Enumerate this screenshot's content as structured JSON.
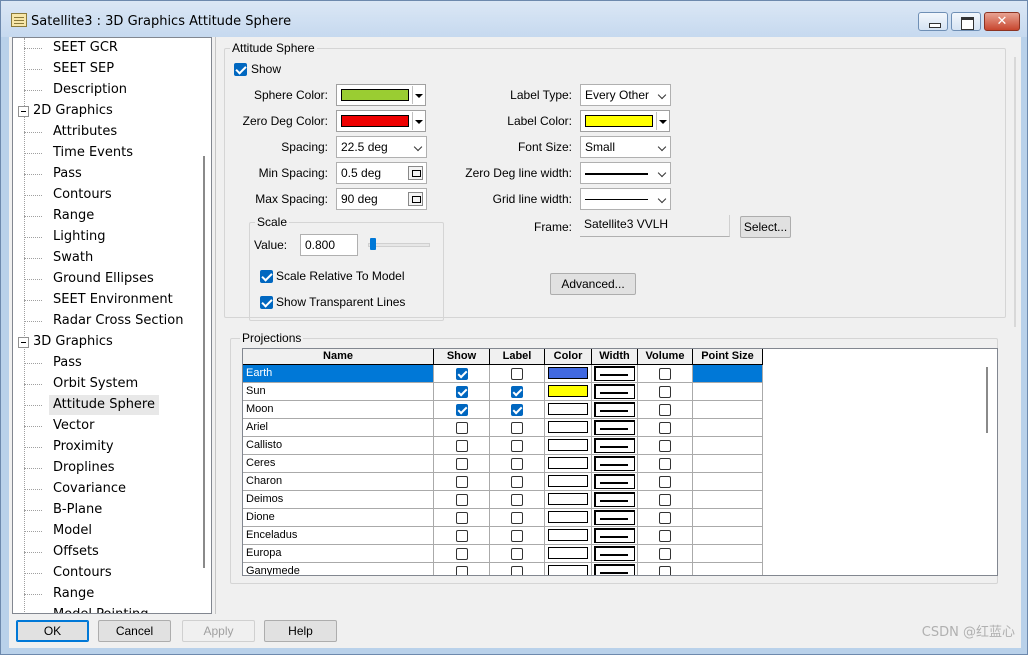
{
  "window": {
    "title": "Satellite3 : 3D Graphics Attitude Sphere",
    "close_glyph": "✕"
  },
  "tree": {
    "items": [
      {
        "label": "SEET GCR",
        "level": 1
      },
      {
        "label": "SEET SEP",
        "level": 1
      },
      {
        "label": "Description",
        "level": 1
      },
      {
        "label": "2D Graphics",
        "level": 0
      },
      {
        "label": "Attributes",
        "level": 1
      },
      {
        "label": "Time Events",
        "level": 1
      },
      {
        "label": "Pass",
        "level": 1
      },
      {
        "label": "Contours",
        "level": 1
      },
      {
        "label": "Range",
        "level": 1
      },
      {
        "label": "Lighting",
        "level": 1
      },
      {
        "label": "Swath",
        "level": 1
      },
      {
        "label": "Ground Ellipses",
        "level": 1
      },
      {
        "label": "SEET Environment",
        "level": 1
      },
      {
        "label": "Radar Cross Section",
        "level": 1
      },
      {
        "label": "3D Graphics",
        "level": 0
      },
      {
        "label": "Pass",
        "level": 1
      },
      {
        "label": "Orbit System",
        "level": 1
      },
      {
        "label": "Attitude Sphere",
        "level": 1
      },
      {
        "label": "Vector",
        "level": 1
      },
      {
        "label": "Proximity",
        "level": 1
      },
      {
        "label": "Droplines",
        "level": 1
      },
      {
        "label": "Covariance",
        "level": 1
      },
      {
        "label": "B-Plane",
        "level": 1
      },
      {
        "label": "Model",
        "level": 1
      },
      {
        "label": "Offsets",
        "level": 1
      },
      {
        "label": "Contours",
        "level": 1
      },
      {
        "label": "Range",
        "level": 1
      },
      {
        "label": "Model Pointing",
        "level": 1
      }
    ]
  },
  "attitude_sphere": {
    "group_label": "Attitude Sphere",
    "show_label": "Show",
    "show_checked": true,
    "sphere_color_label": "Sphere Color:",
    "sphere_color": "#9acd32",
    "zero_deg_color_label": "Zero Deg Color:",
    "zero_deg_color": "#ee0000",
    "spacing_label": "Spacing:",
    "spacing_value": "22.5 deg",
    "min_spacing_label": "Min Spacing:",
    "min_spacing_value": "0.5 deg",
    "max_spacing_label": "Max Spacing:",
    "max_spacing_value": "90 deg",
    "label_type_label": "Label Type:",
    "label_type_value": "Every Other",
    "label_color_label": "Label Color:",
    "label_color": "#ffff00",
    "font_size_label": "Font Size:",
    "font_size_value": "Small",
    "zero_deg_line_width_label": "Zero Deg line width:",
    "grid_line_width_label": "Grid line width:",
    "frame_label": "Frame:",
    "frame_value": "Satellite3 VVLH",
    "select_button": "Select...",
    "advanced_button": "Advanced...",
    "scale": {
      "group_label": "Scale",
      "value_label": "Value:",
      "value": "0.800",
      "scale_relative_label": "Scale Relative To Model",
      "scale_relative_checked": true,
      "show_transparent_label": "Show Transparent Lines",
      "show_transparent_checked": true
    }
  },
  "projections": {
    "group_label": "Projections",
    "columns": [
      "Name",
      "Show",
      "Label",
      "Color",
      "Width",
      "Volume",
      "Point Size"
    ],
    "rows": [
      {
        "name": "Earth",
        "show": true,
        "label": false,
        "color": "#4169e1",
        "volume": false,
        "selected": true
      },
      {
        "name": "Sun",
        "show": true,
        "label": true,
        "color": "#ffff00",
        "volume": false,
        "selected": false
      },
      {
        "name": "Moon",
        "show": true,
        "label": true,
        "color": "#ffffff",
        "volume": false,
        "selected": false
      },
      {
        "name": "Ariel",
        "show": false,
        "label": false,
        "color": "#ffffff",
        "volume": false,
        "selected": false
      },
      {
        "name": "Callisto",
        "show": false,
        "label": false,
        "color": "#ffffff",
        "volume": false,
        "selected": false
      },
      {
        "name": "Ceres",
        "show": false,
        "label": false,
        "color": "#ffffff",
        "volume": false,
        "selected": false
      },
      {
        "name": "Charon",
        "show": false,
        "label": false,
        "color": "#ffffff",
        "volume": false,
        "selected": false
      },
      {
        "name": "Deimos",
        "show": false,
        "label": false,
        "color": "#ffffff",
        "volume": false,
        "selected": false
      },
      {
        "name": "Dione",
        "show": false,
        "label": false,
        "color": "#ffffff",
        "volume": false,
        "selected": false
      },
      {
        "name": "Enceladus",
        "show": false,
        "label": false,
        "color": "#ffffff",
        "volume": false,
        "selected": false
      },
      {
        "name": "Europa",
        "show": false,
        "label": false,
        "color": "#ffffff",
        "volume": false,
        "selected": false
      },
      {
        "name": "Ganymede",
        "show": false,
        "label": false,
        "color": "#ffffff",
        "volume": false,
        "selected": false
      }
    ]
  },
  "buttons": {
    "ok": "OK",
    "cancel": "Cancel",
    "apply": "Apply",
    "help": "Help"
  },
  "watermark": "CSDN @红蓝心"
}
